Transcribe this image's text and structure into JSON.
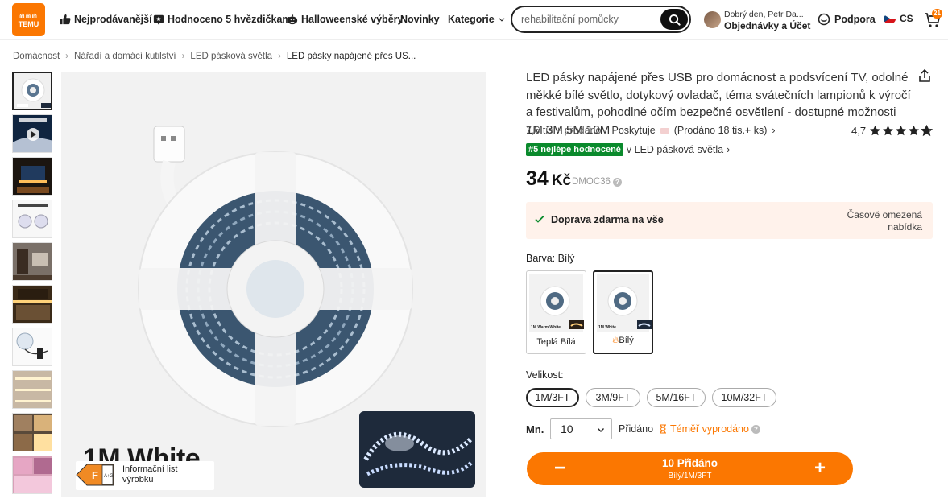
{
  "header": {
    "logo": "TEMU",
    "nav": [
      {
        "label": "Nejprodávanější",
        "icon": "thumbs-up-icon"
      },
      {
        "label": "Hodnoceno 5 hvězdičkami",
        "icon": "star-box-icon"
      },
      {
        "label": "Halloweenské výběry",
        "icon": "pumpkin-icon"
      },
      {
        "label": "Novinky"
      },
      {
        "label": "Kategorie",
        "icon": "chevron-down-icon"
      }
    ],
    "search_placeholder": "rehabilitační pomůcky",
    "greeting": "Dobrý den, Petr Da...",
    "orders_label": "Objednávky a Účet",
    "support_label": "Podpora",
    "language": "CS",
    "cart_count": "21"
  },
  "breadcrumb": [
    "Domácnost",
    "Nářadí a domácí kutilství",
    "LED pásková světla",
    "LED pásky napájené přes US..."
  ],
  "gallery": {
    "main_label": "1M White",
    "energy_class": "F",
    "energy_scale": "A↑G",
    "product_info_label": "Informační list výrobku"
  },
  "product": {
    "title": "LED pásky napájené přes USB pro domácnost a podsvícení TV, odolné měkké bílé světlo, dotykový ovladač, téma svátečních lampionů k výročí a festivalům, pohodlné očím bezpečné osvětlení - dostupné možnosti 1M 3M 5M 10M",
    "sold": "7,6 tis.+ prodáno",
    "provider_label": "Poskytuje",
    "provider_sold": "(Prodáno 18 tis.+ ks)",
    "rating": "4,7",
    "best_badge": "#5 nejlépe hodnocené",
    "best_category": "v LED pásková světla",
    "price": "34",
    "currency": "Kč",
    "sku": "DMOC36"
  },
  "shipping": {
    "text": "Doprava zdarma na vše",
    "note": "Časově omezená nabídka"
  },
  "color": {
    "label": "Barva: Bílý",
    "options": [
      {
        "label": "Teplá Bílá",
        "tag": "1M Warm White"
      },
      {
        "label": "Bílý",
        "tag": "1M White"
      }
    ]
  },
  "size": {
    "label": "Velikost:",
    "options": [
      "1M/3FT",
      "3M/9FT",
      "5M/16FT",
      "10M/32FT"
    ]
  },
  "quantity": {
    "label": "Mn.",
    "value": "10",
    "added": "Přidáno",
    "stock": "Téměř vyprodáno"
  },
  "cta": {
    "line1": "10 Přidáno",
    "line2": "Bílý/1M/3FT"
  },
  "colors": {
    "accent": "#fb7701",
    "badge_green": "#0a8a2c",
    "ship_bg": "#fff2eb"
  }
}
